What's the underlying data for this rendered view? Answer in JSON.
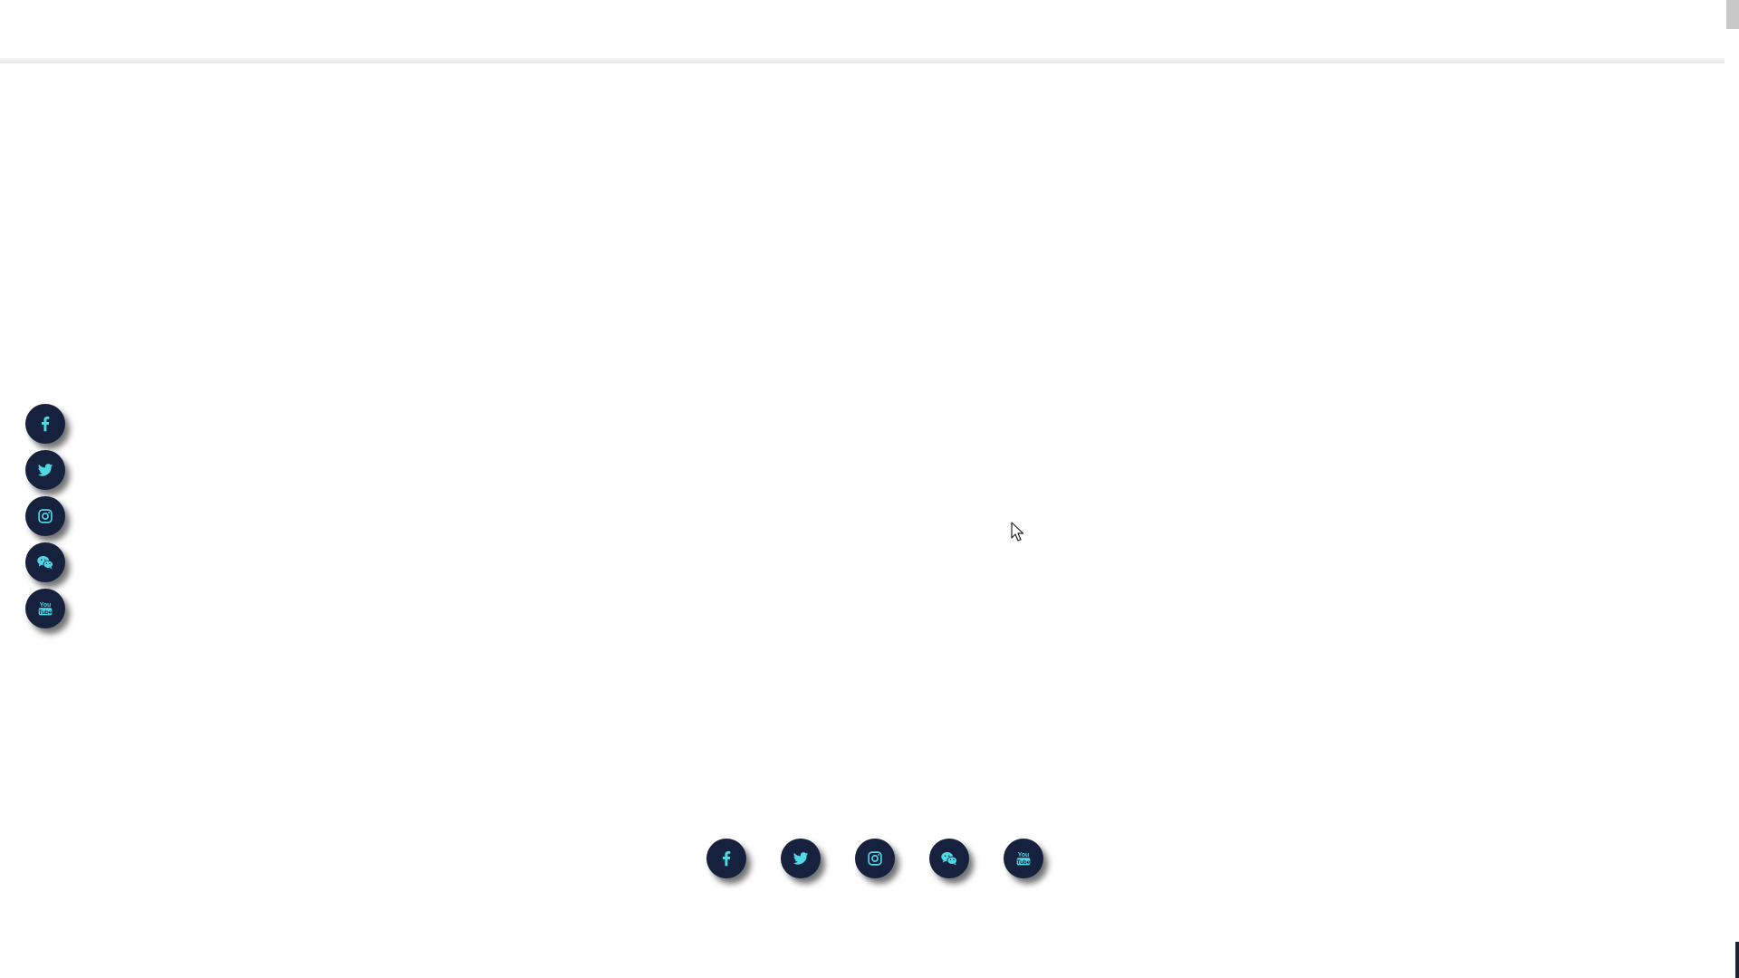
{
  "accent_color": "#4fd8e6",
  "button_color": "#16213d",
  "header": {},
  "side_social": [
    {
      "icon": "facebook-icon",
      "label": "Facebook"
    },
    {
      "icon": "twitter-icon",
      "label": "Twitter"
    },
    {
      "icon": "instagram-icon",
      "label": "Instagram"
    },
    {
      "icon": "wechat-icon",
      "label": "WeChat"
    },
    {
      "icon": "youtube-icon",
      "label": "YouTube"
    }
  ],
  "footer_social": [
    {
      "icon": "facebook-icon",
      "label": "Facebook"
    },
    {
      "icon": "twitter-icon",
      "label": "Twitter"
    },
    {
      "icon": "instagram-icon",
      "label": "Instagram"
    },
    {
      "icon": "wechat-icon",
      "label": "WeChat"
    },
    {
      "icon": "youtube-icon",
      "label": "YouTube"
    }
  ]
}
